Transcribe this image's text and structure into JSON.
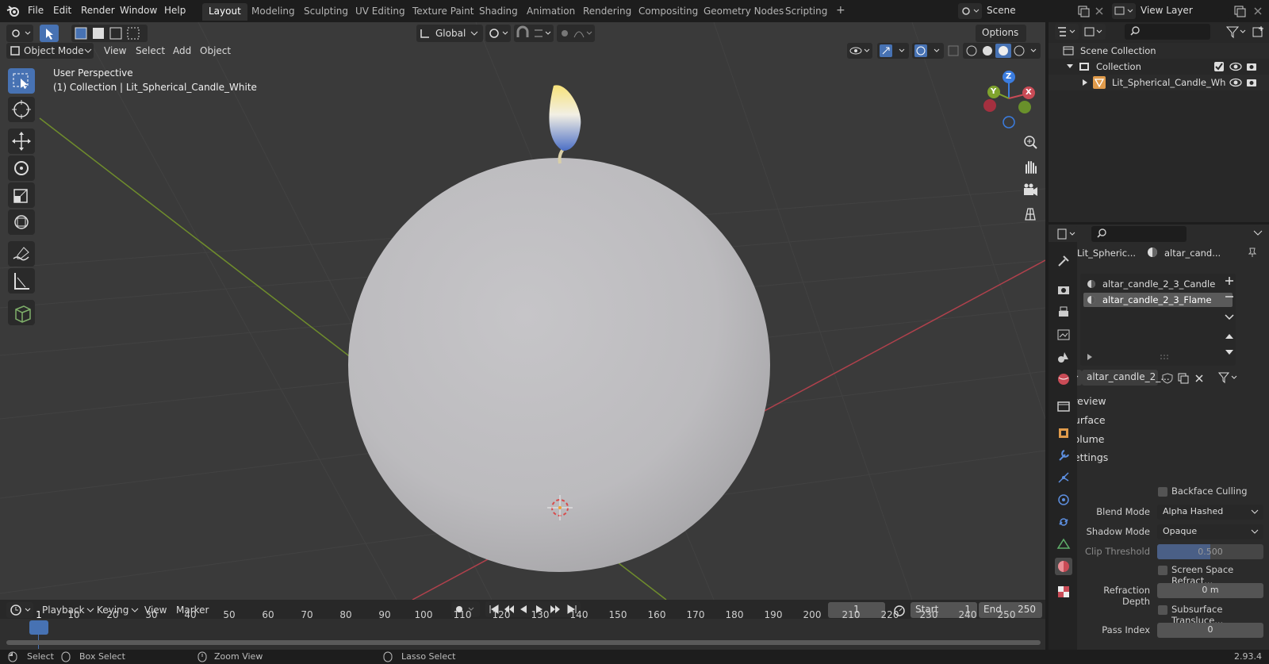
{
  "topbar": {
    "menus": [
      "File",
      "Edit",
      "Render",
      "Window",
      "Help"
    ],
    "workspaces": [
      "Layout",
      "Modeling",
      "Sculpting",
      "UV Editing",
      "Texture Paint",
      "Shading",
      "Animation",
      "Rendering",
      "Compositing",
      "Geometry Nodes",
      "Scripting"
    ],
    "active_workspace": "Layout",
    "add_tab": "+",
    "scene": "Scene",
    "view_layer": "View Layer"
  },
  "viewport": {
    "mode": "Object Mode",
    "menus": [
      "View",
      "Select",
      "Add",
      "Object"
    ],
    "transform_orientation": "Global",
    "options_label": "Options",
    "info_line1": "User Perspective",
    "info_line2": "(1) Collection | Lit_Spherical_Candle_White",
    "gizmo": {
      "x": "X",
      "y": "Y",
      "z": "Z"
    }
  },
  "timeline": {
    "menus": [
      "Playback",
      "Keying",
      "View",
      "Marker"
    ],
    "current_frame": "1",
    "start_label": "Start",
    "start": "1",
    "end_label": "End",
    "end": "250",
    "ticks": [
      "1",
      "10",
      "20",
      "30",
      "40",
      "50",
      "60",
      "70",
      "80",
      "90",
      "100",
      "110",
      "120",
      "130",
      "140",
      "150",
      "160",
      "170",
      "180",
      "190",
      "200",
      "210",
      "220",
      "230",
      "240",
      "250"
    ]
  },
  "statusbar": {
    "items": [
      "Select",
      "Box Select",
      "Zoom View",
      "Lasso Select"
    ],
    "version": "2.93.4"
  },
  "outliner": {
    "scene_collection": "Scene Collection",
    "collection": "Collection",
    "object": "Lit_Spherical_Candle_Wh"
  },
  "properties": {
    "object_name": "Lit_Spheric...",
    "material_name": "altar_cand...",
    "slots": [
      "altar_candle_2_3_Candle",
      "altar_candle_2_3_Flame"
    ],
    "active_material": "altar_candle_2_...",
    "panels": {
      "preview": "Preview",
      "surface": "Surface",
      "volume": "Volume",
      "settings": "Settings"
    },
    "settings": {
      "backface_culling": "Backface Culling",
      "blend_mode_label": "Blend Mode",
      "blend_mode": "Alpha Hashed",
      "shadow_mode_label": "Shadow Mode",
      "shadow_mode": "Opaque",
      "clip_threshold_label": "Clip Threshold",
      "clip_threshold": "0.500",
      "screen_space_refraction": "Screen Space Refract...",
      "refraction_depth_label": "Refraction Depth",
      "refraction_depth": "0 m",
      "subsurface_translucency": "Subsurface Transluce...",
      "pass_index_label": "Pass Index",
      "pass_index": "0"
    }
  },
  "colors": {
    "accent": "#4772b3",
    "active_tab": "#303030",
    "x_axis": "#c94b56",
    "y_axis": "#7fa32d",
    "z_axis": "#3b7de0"
  }
}
